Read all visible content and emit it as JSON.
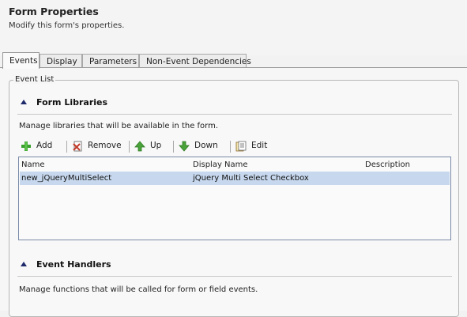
{
  "header": {
    "title": "Form Properties",
    "subtitle": "Modify this form's properties."
  },
  "tabs": [
    {
      "label": "Events",
      "active": true
    },
    {
      "label": "Display",
      "active": false
    },
    {
      "label": "Parameters",
      "active": false
    },
    {
      "label": "Non-Event Dependencies",
      "active": false
    }
  ],
  "event_list": {
    "label": "Event List",
    "form_libraries": {
      "title": "Form Libraries",
      "description": "Manage libraries that will be available in the form.",
      "toolbar": {
        "add": "Add",
        "remove": "Remove",
        "up": "Up",
        "down": "Down",
        "edit": "Edit"
      },
      "columns": [
        "Name",
        "Display Name",
        "Description"
      ],
      "rows": [
        {
          "name": "new_jQueryMultiSelect",
          "display_name": "jQuery Multi Select Checkbox",
          "description": ""
        }
      ]
    },
    "event_handlers": {
      "title": "Event Handlers",
      "description": "Manage functions that will be called for form or field events."
    }
  },
  "colors": {
    "selected_row": "#c7d8ee",
    "add_icon": "#3aa02e",
    "remove_icon": "#c23a2a",
    "arrow_icon": "#4aa33a"
  }
}
